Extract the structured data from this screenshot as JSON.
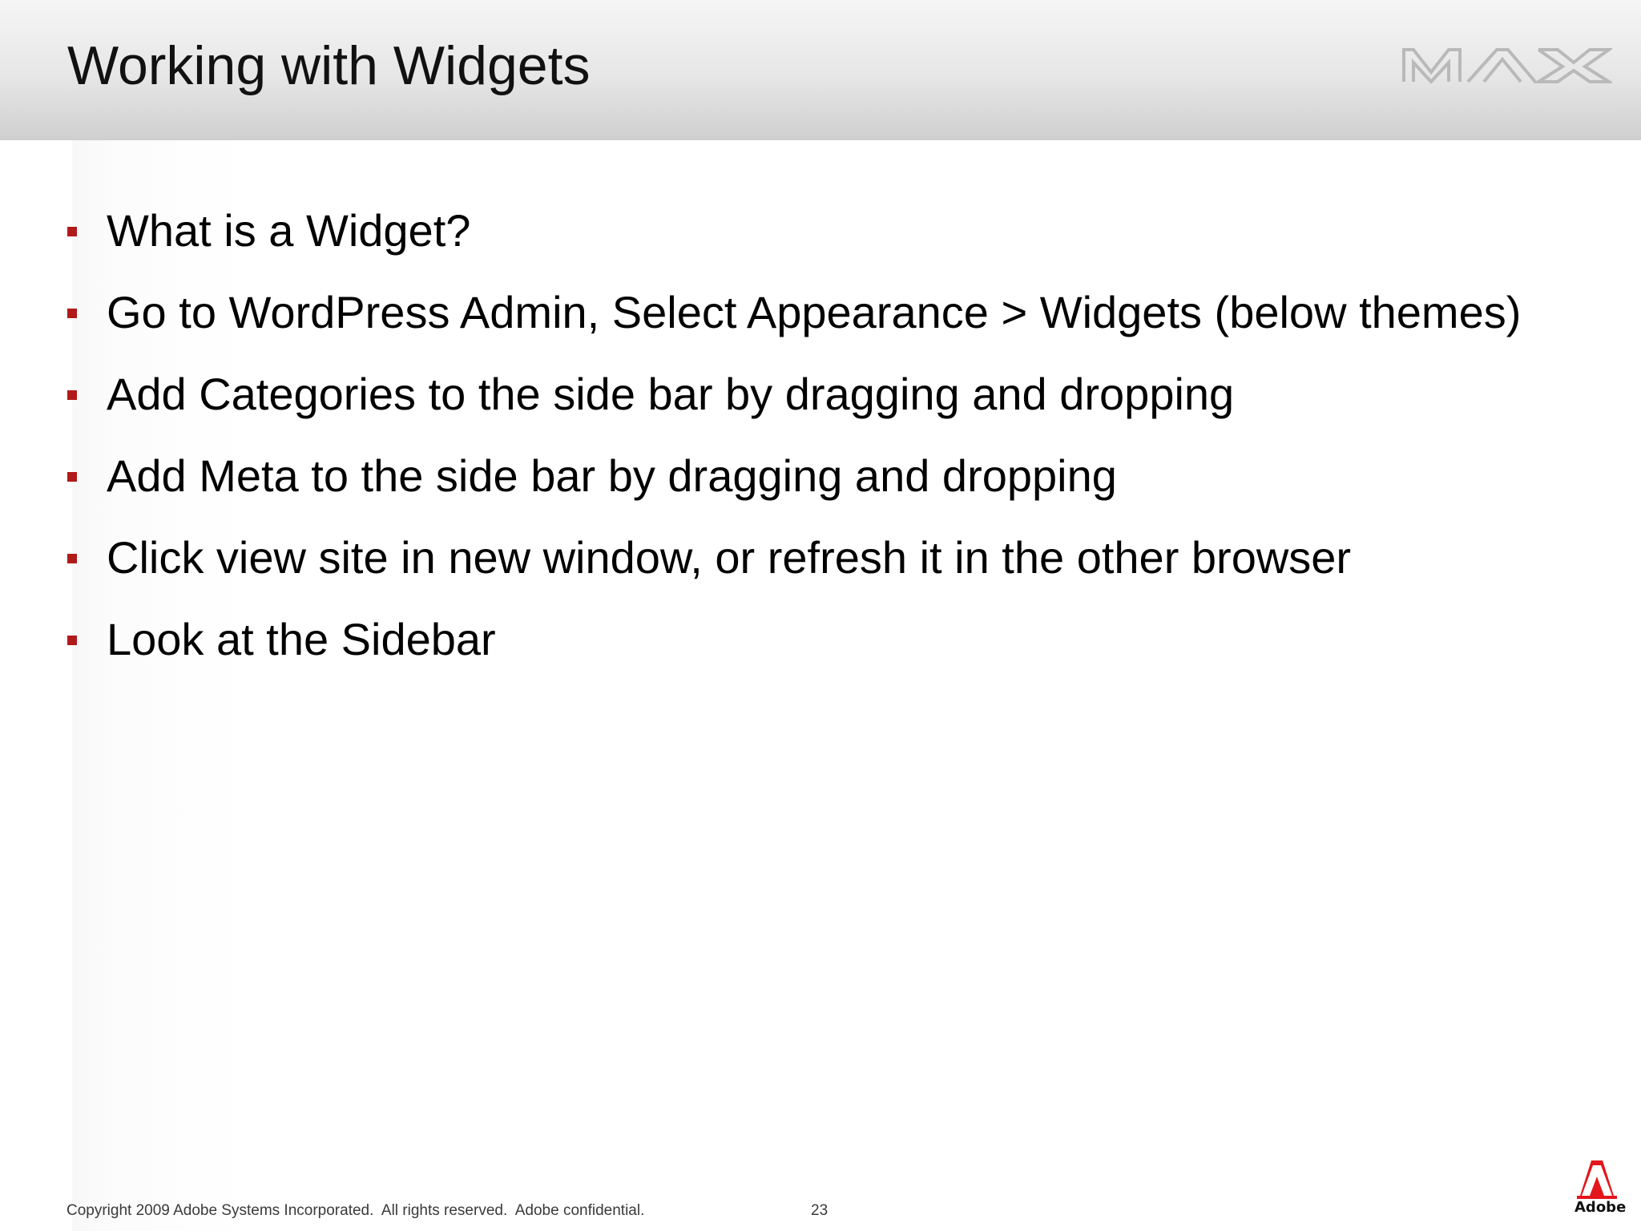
{
  "header": {
    "title": "Working with Widgets",
    "logo_text": "MAX"
  },
  "bullets": [
    "What is a Widget?",
    "Go to WordPress Admin, Select Appearance > Widgets (below themes)",
    "Add Categories to the side bar by dragging and dropping",
    "Add Meta to the side bar by dragging and dropping",
    "Click view site in new window, or refresh it in the other browser",
    "Look at the Sidebar"
  ],
  "footer": {
    "copyright": "Copyright 2009 Adobe Systems Incorporated.  All rights reserved.  Adobe confidential.",
    "page_number": "23",
    "brand_logo_text": "Adobe"
  },
  "colors": {
    "bullet_marker": "#b01a1a",
    "adobe_red": "#e3161b"
  }
}
